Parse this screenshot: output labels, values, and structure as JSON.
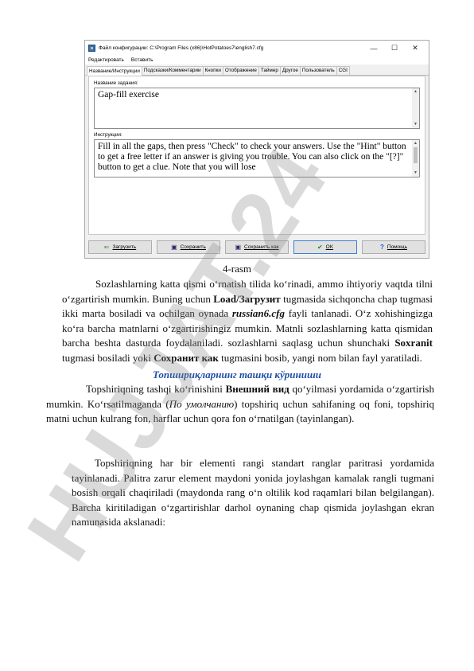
{
  "dialog": {
    "title": "Файл конфигурации: C:\\Program Files (x86)\\HotPotatoes7\\english7.cfg",
    "win_min": "—",
    "win_max": "☐",
    "win_close": "✕",
    "menu": [
      "Редактировать",
      "Вставить"
    ],
    "tabs": [
      "Название/Инструкции",
      "Подсказки/Комментарии",
      "Кнопки",
      "Отображение",
      "Таймер",
      "Другое",
      "Пользователь",
      "CGI"
    ],
    "name_label": "Название задания:",
    "name_value": "Gap-fill exercise",
    "instructions_label": "Инструкции:",
    "instructions_value": "Fill in all the gaps, then press \"Check\" to check your answers. Use the \"Hint\" button to get a free letter if an answer is giving you trouble. You can also click on the \"[?]\" button to get a clue. Note that you will lose",
    "buttons": {
      "load": "Загрузить",
      "save": "Сохранить",
      "save_as": "Сохранить как",
      "ok": "OK",
      "help": "Помощь"
    }
  },
  "figure_caption": "4-rasm",
  "para1": {
    "t1": "Sozlashlarning katta qismi o‘rnatish tilida ko‘rinadi, ammo ihtiyoriy vaqtda tilni o‘zgartirish mumkin. Buning uchun ",
    "b1": "Load/Загрузит",
    "t2": " tugmasida sichqoncha chap tugmasi ikki marta bosiladi va ochilgan oynada ",
    "b2": "russian6.cfg",
    "t3": " fayli tanlanadi. O‘z xohishingizga ko‘ra barcha matnlarni o‘zgartirishingiz mumkin. Matnli sozlashlarning katta qismidan barcha beshta dasturda foydalaniladi. sozlashlarni saqlasg uchun shunchaki ",
    "b3": "Soxranit",
    "t4": " tugmasi bosiladi yoki ",
    "b4": "Сохранит как",
    "t5": " tugmasini bosib, yangi nom bilan fayl yaratiladi."
  },
  "heading": "Топшириқларнинг ташқи кўриниши",
  "para2": {
    "t1": "Topshiriqning tashqi ko‘rinishini ",
    "b1": "Внешний вид",
    "t2": " qo‘yilmasi yordamida o‘zgartirish mumkin. Ko‘rsatilmaganda (",
    "i1": "По умолчанию",
    "t3": ") topshiriq uchun sahifaning oq foni, topshiriq matni uchun kulrang fon, harflar uchun qora fon o‘rnatilgan (tayinlangan)."
  },
  "para3": "Topshiriqning har bir elementi rangi standart ranglar paritrasi yordamida tayinlanadi. Palitra zarur element maydoni yonida joylashgan kamalak rangli tugmani bosish orqali chaqiriladi (maydonda rang o‘n oltilik kod raqamlari bilan belgilangan). Barcha kiritiladigan o‘zgartirishlar darhol oynaning chap qismida joylashgan ekran namunasida akslanadi:",
  "watermark": "HUJJAT.24",
  "colors": {
    "heading": "#1f4ea8",
    "watermark": "#8c8c8c",
    "ok_border": "#3c7fd6"
  }
}
